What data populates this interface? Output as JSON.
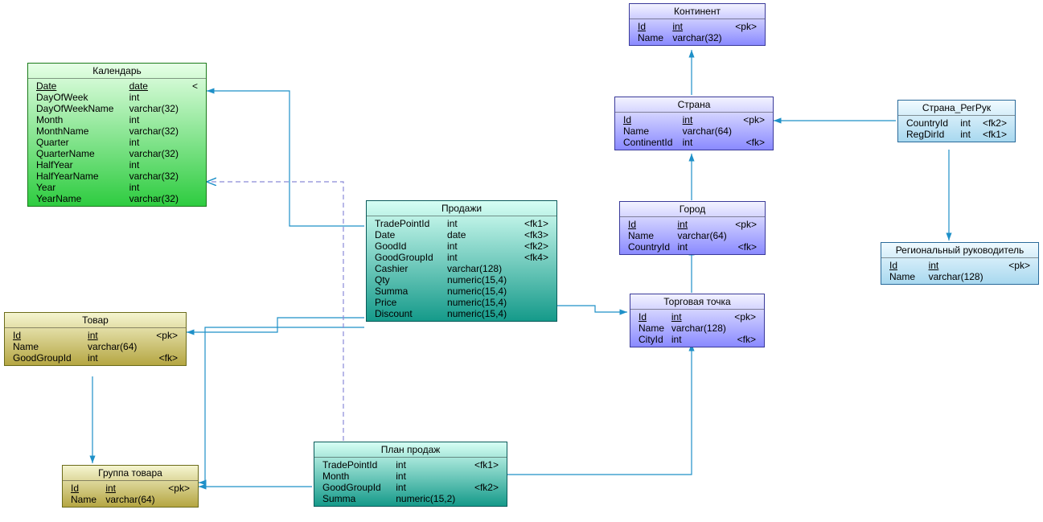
{
  "calendar": {
    "title": "Календарь",
    "cols": [
      {
        "n": "Date",
        "t": "date",
        "k": "<"
      },
      {
        "n": "DayOfWeek",
        "t": "int"
      },
      {
        "n": "DayOfWeekName",
        "t": "varchar(32)"
      },
      {
        "n": "Month",
        "t": "int"
      },
      {
        "n": "MonthName",
        "t": "varchar(32)"
      },
      {
        "n": "Quarter",
        "t": "int"
      },
      {
        "n": "QuarterName",
        "t": "varchar(32)"
      },
      {
        "n": "HalfYear",
        "t": "int"
      },
      {
        "n": "HalfYearName",
        "t": "varchar(32)"
      },
      {
        "n": "Year",
        "t": "int"
      },
      {
        "n": "YearName",
        "t": "varchar(32)"
      }
    ]
  },
  "good": {
    "title": "Товар",
    "cols": [
      {
        "n": "Id",
        "t": "int",
        "k": "<pk>"
      },
      {
        "n": "Name",
        "t": "varchar(64)"
      },
      {
        "n": "GoodGroupId",
        "t": "int",
        "k": "<fk>"
      }
    ]
  },
  "goodgroup": {
    "title": "Группа товара",
    "cols": [
      {
        "n": "Id",
        "t": "int",
        "k": "<pk>"
      },
      {
        "n": "Name",
        "t": "varchar(64)"
      }
    ]
  },
  "sales": {
    "title": "Продажи",
    "cols": [
      {
        "n": "TradePointId",
        "t": "int",
        "k": "<fk1>"
      },
      {
        "n": "Date",
        "t": "date",
        "k": "<fk3>"
      },
      {
        "n": "GoodId",
        "t": "int",
        "k": "<fk2>"
      },
      {
        "n": "GoodGroupId",
        "t": "int",
        "k": "<fk4>"
      },
      {
        "n": "Cashier",
        "t": "varchar(128)"
      },
      {
        "n": "Qty",
        "t": "numeric(15,4)"
      },
      {
        "n": "Summa",
        "t": "numeric(15,4)"
      },
      {
        "n": "Price",
        "t": "numeric(15,4)"
      },
      {
        "n": "Discount",
        "t": "numeric(15,4)"
      }
    ]
  },
  "plan": {
    "title": "План продаж",
    "cols": [
      {
        "n": "TradePointId",
        "t": "int",
        "k": "<fk1>"
      },
      {
        "n": "Month",
        "t": "int"
      },
      {
        "n": "GoodGroupId",
        "t": "int",
        "k": "<fk2>"
      },
      {
        "n": "Summa",
        "t": "numeric(15,2)"
      }
    ]
  },
  "continent": {
    "title": "Континент",
    "cols": [
      {
        "n": "Id",
        "t": "int",
        "k": "<pk>"
      },
      {
        "n": "Name",
        "t": "varchar(32)"
      }
    ]
  },
  "country": {
    "title": "Страна",
    "cols": [
      {
        "n": "Id",
        "t": "int",
        "k": "<pk>"
      },
      {
        "n": "Name",
        "t": "varchar(64)"
      },
      {
        "n": "ContinentId",
        "t": "int",
        "k": "<fk>"
      }
    ]
  },
  "city": {
    "title": "Город",
    "cols": [
      {
        "n": "Id",
        "t": "int",
        "k": "<pk>"
      },
      {
        "n": "Name",
        "t": "varchar(64)"
      },
      {
        "n": "CountryId",
        "t": "int",
        "k": "<fk>"
      }
    ]
  },
  "tradepoint": {
    "title": "Торговая точка",
    "cols": [
      {
        "n": "Id",
        "t": "int",
        "k": "<pk>"
      },
      {
        "n": "Name",
        "t": "varchar(128)"
      },
      {
        "n": "CityId",
        "t": "int",
        "k": "<fk>"
      }
    ]
  },
  "countryreg": {
    "title": "Страна_РегРук",
    "cols": [
      {
        "n": "CountryId",
        "t": "int",
        "k": "<fk2>"
      },
      {
        "n": "RegDirId",
        "t": "int",
        "k": "<fk1>"
      }
    ]
  },
  "regdir": {
    "title": "Региональный руководитель",
    "cols": [
      {
        "n": "Id",
        "t": "int",
        "k": "<pk>"
      },
      {
        "n": "Name",
        "t": "varchar(128)"
      }
    ]
  },
  "relationships": [
    {
      "from": "Продажи",
      "to": "Календарь",
      "style": "solid"
    },
    {
      "from": "Продажи",
      "to": "Товар",
      "style": "solid"
    },
    {
      "from": "Продажи",
      "to": "Группа товара",
      "style": "solid"
    },
    {
      "from": "Продажи",
      "to": "Торговая точка",
      "style": "solid"
    },
    {
      "from": "Товар",
      "to": "Группа товара",
      "style": "solid"
    },
    {
      "from": "План продаж",
      "to": "Группа товара",
      "style": "solid"
    },
    {
      "from": "План продаж",
      "to": "Календарь",
      "style": "dashed"
    },
    {
      "from": "План продаж",
      "to": "Торговая точка",
      "style": "solid"
    },
    {
      "from": "Торговая точка",
      "to": "Город",
      "style": "solid"
    },
    {
      "from": "Город",
      "to": "Страна",
      "style": "solid"
    },
    {
      "from": "Страна",
      "to": "Континент",
      "style": "solid"
    },
    {
      "from": "Страна_РегРук",
      "to": "Страна",
      "style": "solid"
    },
    {
      "from": "Страна_РегРук",
      "to": "Региональный руководитель",
      "style": "solid"
    }
  ]
}
